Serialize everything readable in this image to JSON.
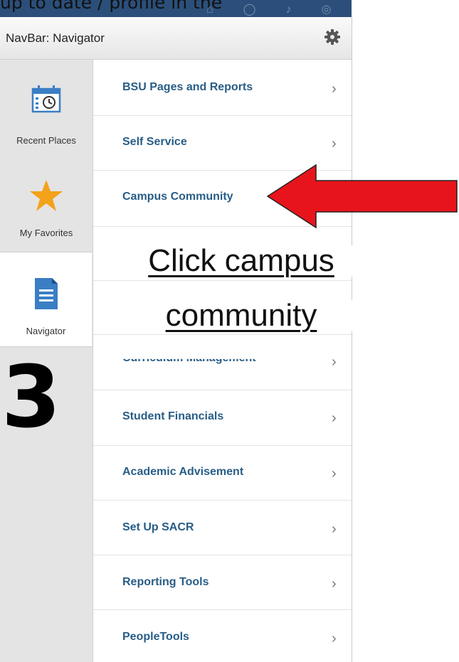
{
  "top_caption": "up to date / profile   in the",
  "topbar_icons": [
    "home-icon",
    "search-icon",
    "bell-icon",
    "compass-icon"
  ],
  "header": {
    "title": "NavBar: Navigator",
    "settings_icon": "gear-icon"
  },
  "sidebar": {
    "items": [
      {
        "label": "Recent Places",
        "icon": "calendar-clock-icon",
        "active": false
      },
      {
        "label": "My Favorites",
        "icon": "star-icon",
        "active": false
      },
      {
        "label": "Navigator",
        "icon": "document-icon",
        "active": true
      }
    ]
  },
  "menu": {
    "items": [
      {
        "label": "BSU Pages and Reports",
        "chevron": "›"
      },
      {
        "label": "Self Service",
        "chevron": "›"
      },
      {
        "label": "Campus Community",
        "chevron": ""
      },
      {
        "label": "Student Financials",
        "chevron": "›"
      },
      {
        "label": "Academic Advisement",
        "chevron": "›"
      },
      {
        "label": "Set Up SACR",
        "chevron": "›"
      },
      {
        "label": "Reporting Tools",
        "chevron": "›"
      },
      {
        "label": "PeopleTools",
        "chevron": "›"
      }
    ],
    "partial_item": "Curriculum Management",
    "partial_chevron": "›"
  },
  "annotation": {
    "line1": "Click campus",
    "line2": "community",
    "step_number": "3",
    "arrow_color": "#e8141b"
  },
  "colors": {
    "menu_text": "#285d87",
    "star": "#f3a21a",
    "icon_blue": "#3a7ec4"
  }
}
